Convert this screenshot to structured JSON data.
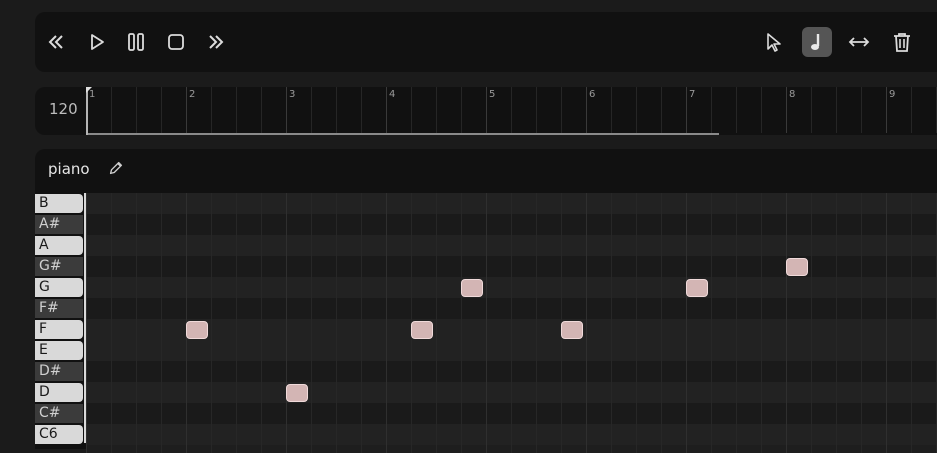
{
  "transport": {
    "buttons": [
      {
        "name": "rewind-button",
        "icon": "rewind-icon"
      },
      {
        "name": "play-button",
        "icon": "play-icon"
      },
      {
        "name": "pause-button",
        "icon": "pause-icon"
      },
      {
        "name": "stop-button",
        "icon": "stop-icon"
      },
      {
        "name": "fast-forward-button",
        "icon": "fast-forward-icon"
      }
    ],
    "tools": [
      {
        "name": "select-tool-button",
        "icon": "cursor-arrow-icon",
        "active": false
      },
      {
        "name": "note-tool-button",
        "icon": "music-note-icon",
        "active": true
      },
      {
        "name": "resize-tool-button",
        "icon": "horizontal-arrows-icon",
        "active": false
      },
      {
        "name": "delete-tool-button",
        "icon": "trash-icon",
        "active": false
      }
    ]
  },
  "timeline": {
    "tempo": "120",
    "bar_labels": [
      "1",
      "2",
      "3",
      "4",
      "5",
      "6",
      "7",
      "8",
      "9"
    ],
    "subdivisions_per_bar": 4,
    "loop_end_beat": 25.3
  },
  "track": {
    "name": "piano",
    "edit_icon": "pencil-icon",
    "keys": [
      {
        "label": "B",
        "color": "white"
      },
      {
        "label": "A#",
        "color": "black"
      },
      {
        "label": "A",
        "color": "white"
      },
      {
        "label": "G#",
        "color": "black"
      },
      {
        "label": "G",
        "color": "white"
      },
      {
        "label": "F#",
        "color": "black"
      },
      {
        "label": "F",
        "color": "white"
      },
      {
        "label": "E",
        "color": "white"
      },
      {
        "label": "D#",
        "color": "black"
      },
      {
        "label": "D",
        "color": "white"
      },
      {
        "label": "C#",
        "color": "black"
      },
      {
        "label": "C6",
        "color": "white"
      }
    ],
    "notes": [
      {
        "pitch": "F",
        "beat": 4
      },
      {
        "pitch": "D",
        "beat": 8
      },
      {
        "pitch": "F",
        "beat": 13
      },
      {
        "pitch": "G",
        "beat": 15
      },
      {
        "pitch": "F",
        "beat": 19
      },
      {
        "pitch": "G",
        "beat": 24
      },
      {
        "pitch": "G#",
        "beat": 28
      }
    ]
  },
  "colors": {
    "note_fill": "#d3b5b4",
    "active_tool": "#555555",
    "panel": "#111111"
  }
}
